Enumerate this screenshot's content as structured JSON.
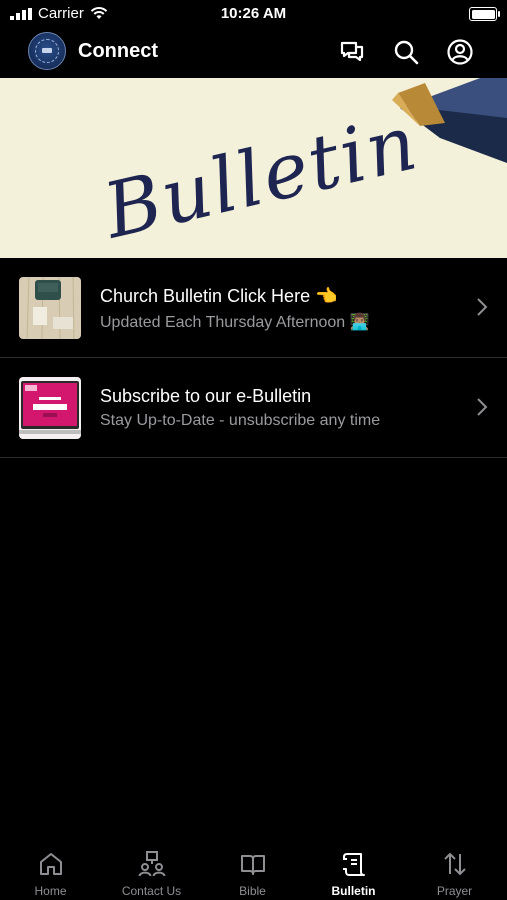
{
  "status_bar": {
    "carrier": "Carrier",
    "time": "10:26 AM",
    "battery_level": 1.0
  },
  "header": {
    "title": "Connect",
    "icons": [
      "messages-icon",
      "search-icon",
      "account-icon"
    ]
  },
  "banner": {
    "text": "Bulletin"
  },
  "list": [
    {
      "title": "Church Bulletin Click Here 👈",
      "subtitle": "Updated Each Thursday Afternoon 👨🏽‍💻",
      "thumbnail": "desk-typewriter-image"
    },
    {
      "title": "Subscribe to our e-Bulletin",
      "subtitle": "Stay Up-to-Date - unsubscribe any time",
      "thumbnail": "newsletter-laptop-image"
    }
  ],
  "tabs": [
    {
      "label": "Home",
      "icon": "home-icon",
      "active": false
    },
    {
      "label": "Contact Us",
      "icon": "contact-icon",
      "active": false
    },
    {
      "label": "Bible",
      "icon": "book-icon",
      "active": false
    },
    {
      "label": "Bulletin",
      "icon": "bulletin-icon",
      "active": true
    },
    {
      "label": "Prayer",
      "icon": "sort-arrows-icon",
      "active": false
    }
  ],
  "colors": {
    "background": "#000000",
    "banner_bg": "#f4f1da",
    "ink": "#1d2550",
    "muted_text": "#9a9a9f",
    "active_tab": "#ffffff",
    "inactive_tab": "#8e8e93"
  }
}
